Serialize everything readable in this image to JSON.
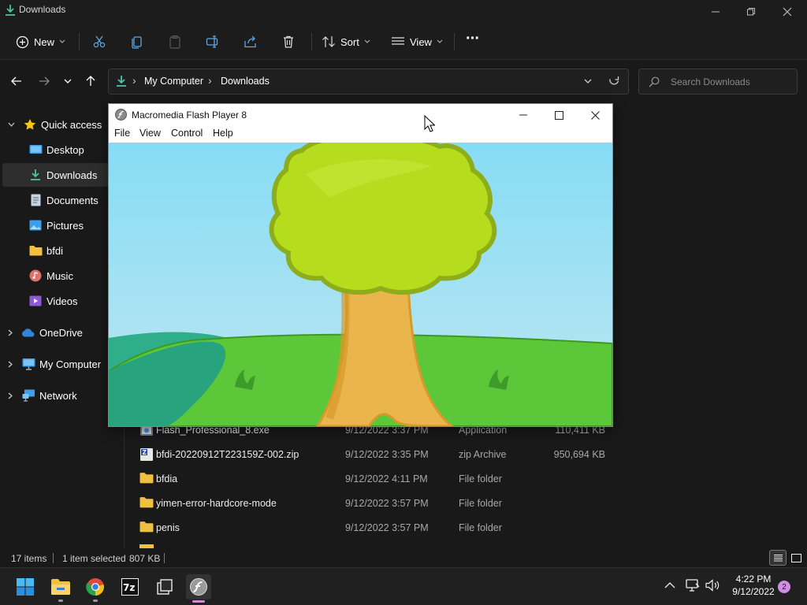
{
  "window": {
    "title": "Downloads"
  },
  "toolbar": {
    "new_label": "New",
    "sort_label": "Sort",
    "view_label": "View",
    "more_label": "···"
  },
  "address": {
    "segments": [
      "My Computer",
      "Downloads"
    ],
    "separator": "›"
  },
  "search": {
    "placeholder": "Search Downloads"
  },
  "sidebar": {
    "quick_access": "Quick access",
    "items": [
      {
        "label": "Desktop",
        "icon": "desktop-icon"
      },
      {
        "label": "Downloads",
        "icon": "download-icon"
      },
      {
        "label": "Documents",
        "icon": "document-icon"
      },
      {
        "label": "Pictures",
        "icon": "picture-icon"
      },
      {
        "label": "bfdi",
        "icon": "folder-icon"
      },
      {
        "label": "Music",
        "icon": "music-icon"
      },
      {
        "label": "Videos",
        "icon": "video-icon"
      }
    ],
    "onedrive": "OneDrive",
    "my_computer": "My Computer",
    "network": "Network"
  },
  "files": [
    {
      "name": "Flash_Professional_8.exe",
      "date": "9/12/2022 3:37 PM",
      "type": "Application",
      "size": "110,411 KB",
      "icon": "application-icon"
    },
    {
      "name": "bfdi-20220912T223159Z-002.zip",
      "date": "9/12/2022 3:35 PM",
      "type": "zip Archive",
      "size": "950,694 KB",
      "icon": "zip-icon"
    },
    {
      "name": "bfdia",
      "date": "9/12/2022 4:11 PM",
      "type": "File folder",
      "size": "",
      "icon": "folder-icon"
    },
    {
      "name": "yimen-error-hardcore-mode",
      "date": "9/12/2022 3:57 PM",
      "type": "File folder",
      "size": "",
      "icon": "folder-icon"
    },
    {
      "name": "penis",
      "date": "9/12/2022 3:57 PM",
      "type": "File folder",
      "size": "",
      "icon": "folder-icon"
    }
  ],
  "status": {
    "item_count": "17 items",
    "selection": "1 item selected",
    "selection_size": "807 KB"
  },
  "flash": {
    "title": "Macromedia Flash Player 8",
    "menu": [
      "File",
      "View",
      "Control",
      "Help"
    ]
  },
  "taskbar": {
    "time": "4:22 PM",
    "date": "9/12/2022",
    "notification_count": "2"
  },
  "colors": {
    "accent_green": "#4cc2a3",
    "folder_yellow": "#f0c040",
    "sky": "#9cdcf0",
    "grass": "#5fc83a",
    "tree_top": "#b5dd1e"
  }
}
